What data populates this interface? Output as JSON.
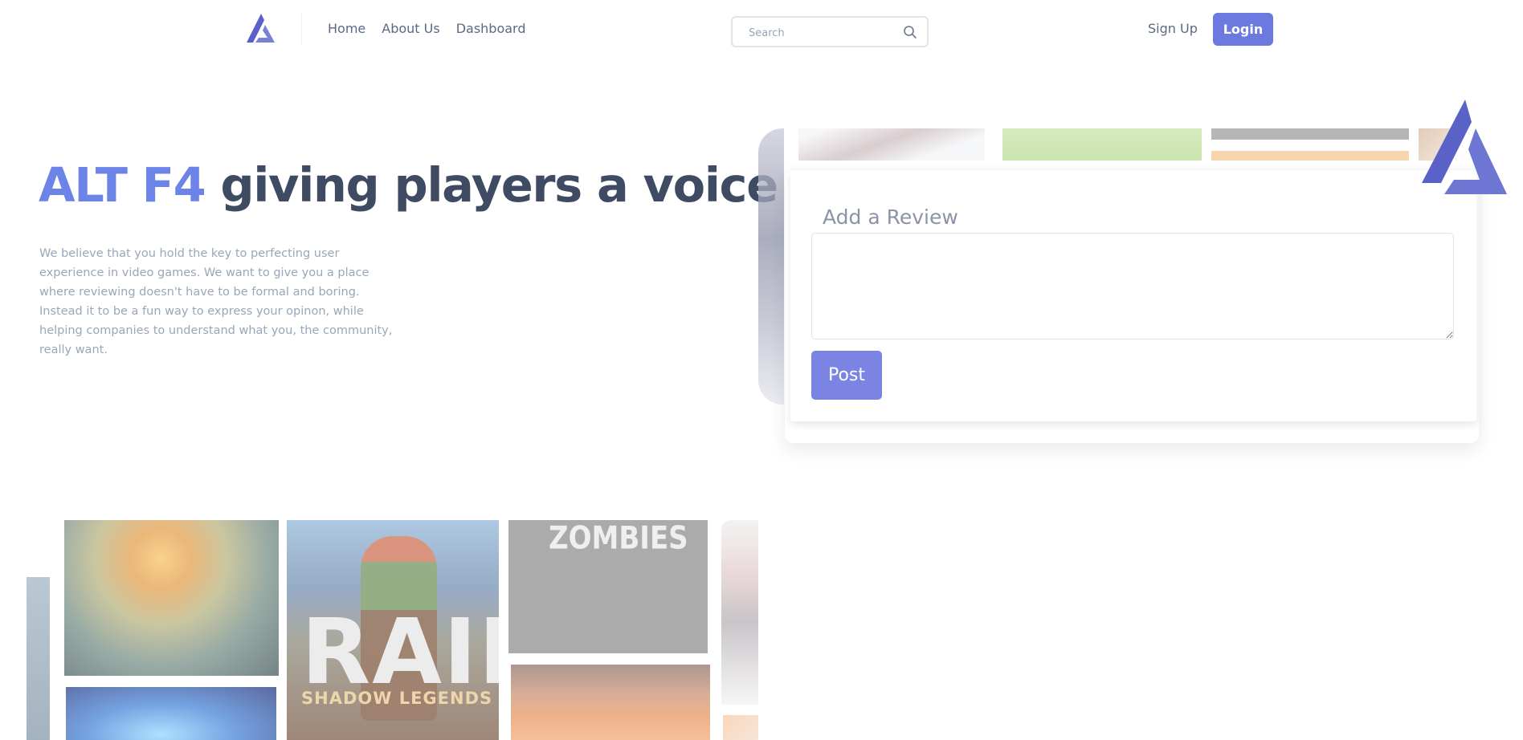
{
  "header": {
    "logo_icon": "alt-f4-logo-icon",
    "nav": [
      {
        "label": "Home"
      },
      {
        "label": "About Us"
      },
      {
        "label": "Dashboard"
      }
    ],
    "search": {
      "placeholder": "Search",
      "value": "",
      "icon": "search-icon"
    },
    "signup_label": "Sign Up",
    "login_label": "Login"
  },
  "hero": {
    "title_accent": "ALT F4",
    "title_rest": " giving players a voice",
    "description": "We believe that you hold the key to perfecting user experience in video games. We want to give you a place where reviewing doesn't have to be formal and boring. Instead it to be a fun way to express your opinon, while helping companies to understand what you, the community, really want."
  },
  "review": {
    "title": "Add a Review",
    "textarea_value": "",
    "post_label": "Post"
  },
  "gallery": {
    "raid_title": "RAID",
    "raid_subtitle": "SHADOW LEGENDS",
    "zombies_title": "ZOMBIES"
  },
  "colors": {
    "accent": "#6c7ae0",
    "title_accent": "#6c83e8",
    "title_text": "#3f4b62",
    "body_text": "#9aa6bb",
    "post_button": "#7b83e3"
  }
}
